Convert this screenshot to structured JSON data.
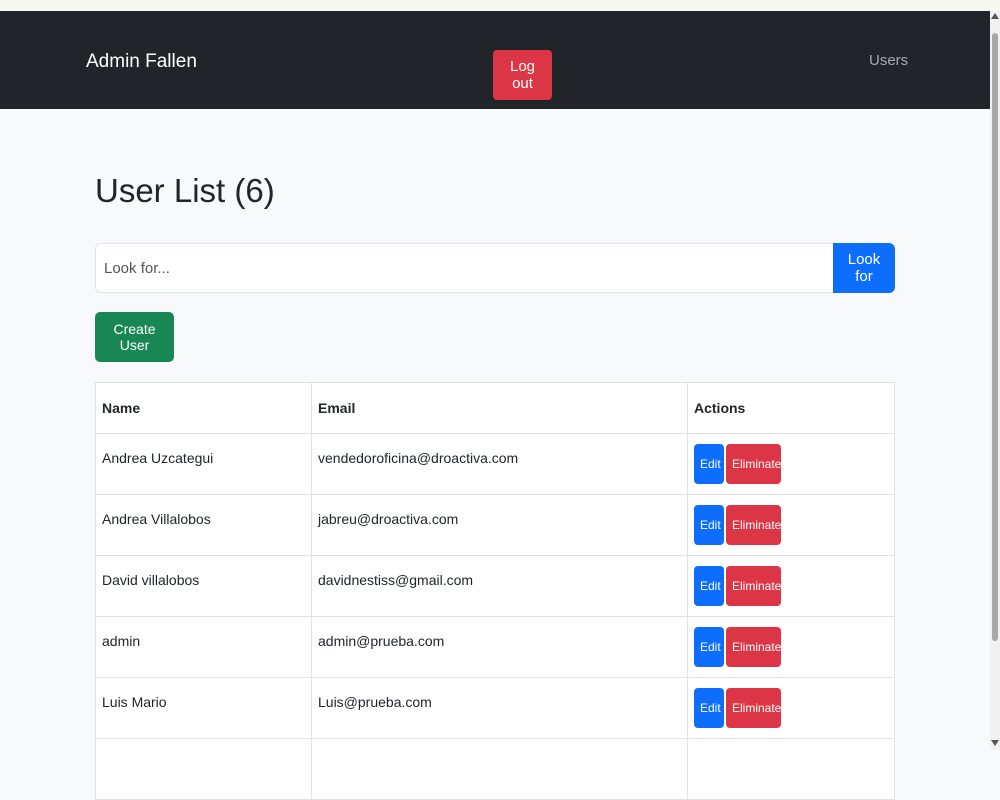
{
  "navbar": {
    "brand": "Admin Fallen",
    "logout_label": "Log out",
    "users_link": "Users"
  },
  "page": {
    "title": "User List (6)"
  },
  "search": {
    "placeholder": "Look for...",
    "button_label": "Look for"
  },
  "create_button_label": "Create User",
  "table": {
    "headers": {
      "name": "Name",
      "email": "Email",
      "actions": "Actions"
    },
    "rows": [
      {
        "name": "Andrea Uzcategui",
        "email": "vendedoroficina@droactiva.com"
      },
      {
        "name": "Andrea Villalobos",
        "email": "jabreu@droactiva.com"
      },
      {
        "name": "David villalobos",
        "email": "davidnestiss@gmail.com"
      },
      {
        "name": "admin",
        "email": "admin@prueba.com"
      },
      {
        "name": "Luis Mario",
        "email": "Luis@prueba.com"
      }
    ],
    "edit_label": "Edit",
    "delete_label": "Eliminate"
  },
  "colors": {
    "navbar": "#212529",
    "danger": "#dc3545",
    "primary": "#0d6efd",
    "success": "#198754"
  }
}
